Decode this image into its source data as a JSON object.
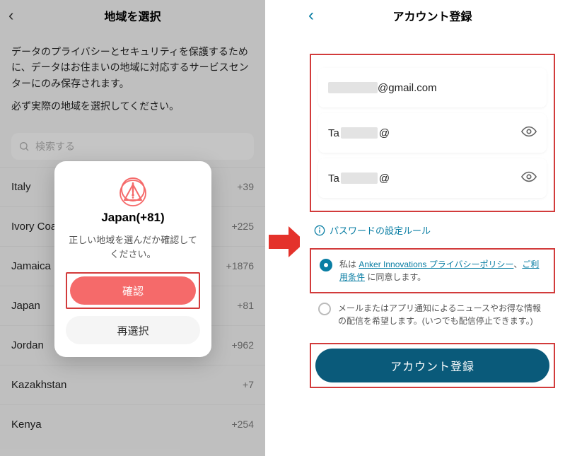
{
  "left": {
    "header": {
      "title": "地域を選択"
    },
    "desc1": "データのプライバシーとセキュリティを保護するために、データはお住まいの地域に対応するサービスセンターにのみ保存されます。",
    "desc2": "必ず実際の地域を選択してください。",
    "search_placeholder": "検索する",
    "rows": [
      {
        "name": "Italy",
        "code": "+39"
      },
      {
        "name": "Ivory Coast",
        "code": "+225"
      },
      {
        "name": "Jamaica",
        "code": "+1876"
      },
      {
        "name": "Japan",
        "code": "+81"
      },
      {
        "name": "Jordan",
        "code": "+962"
      },
      {
        "name": "Kazakhstan",
        "code": "+7"
      },
      {
        "name": "Kenya",
        "code": "+254"
      }
    ],
    "modal": {
      "title": "Japan(+81)",
      "desc": "正しい地域を選んだか確認してください。",
      "confirm": "確認",
      "reselect": "再選択"
    }
  },
  "right": {
    "header": {
      "title": "アカウント登録"
    },
    "email_suffix": "@gmail.com",
    "pwd_prefix": "Ta",
    "pwd_suffix": "@",
    "rule_link": "パスワードの設定ルール",
    "consent_pre": "私は",
    "consent_link1": "Anker Innovations プライバシーポリシー",
    "consent_sep": "、",
    "consent_link2": "ご利用条件",
    "consent_post": " に同意します。",
    "newsletter": "メールまたはアプリ通知によるニュースやお得な情報の配信を希望します。(いつでも配信停止できます。)",
    "register_btn": "アカウント登録"
  }
}
